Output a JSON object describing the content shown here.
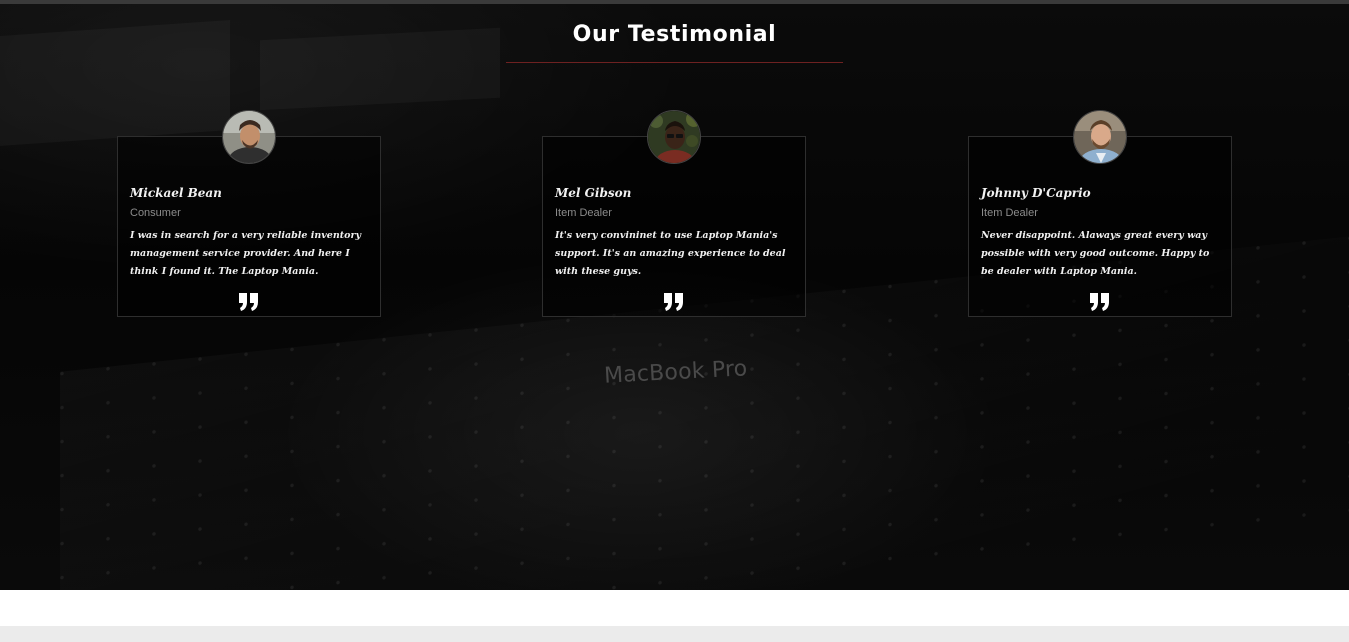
{
  "section": {
    "title": "Our Testimonial",
    "accent_color": "#6e2121"
  },
  "background": {
    "brand_text": "MacBook Pro"
  },
  "testimonials": [
    {
      "name": "Mickael Bean",
      "role": "Consumer",
      "quote": "I was in search for a very reliable inventory management service provider. And here I think I found it. The Laptop Mania.",
      "avatar_icon": "person-avatar"
    },
    {
      "name": "Mel Gibson",
      "role": "Item Dealer",
      "quote": "It's very convininet to use Laptop Mania's support. It's an amazing experience to deal with these guys.",
      "avatar_icon": "person-avatar"
    },
    {
      "name": "Johnny D'Caprio",
      "role": "Item Dealer",
      "quote": "Never disappoint. Alaways great every way possible with very good outcome. Happy to be dealer with Laptop Mania.",
      "avatar_icon": "person-avatar"
    }
  ],
  "quote_icon": "quote-close-icon"
}
